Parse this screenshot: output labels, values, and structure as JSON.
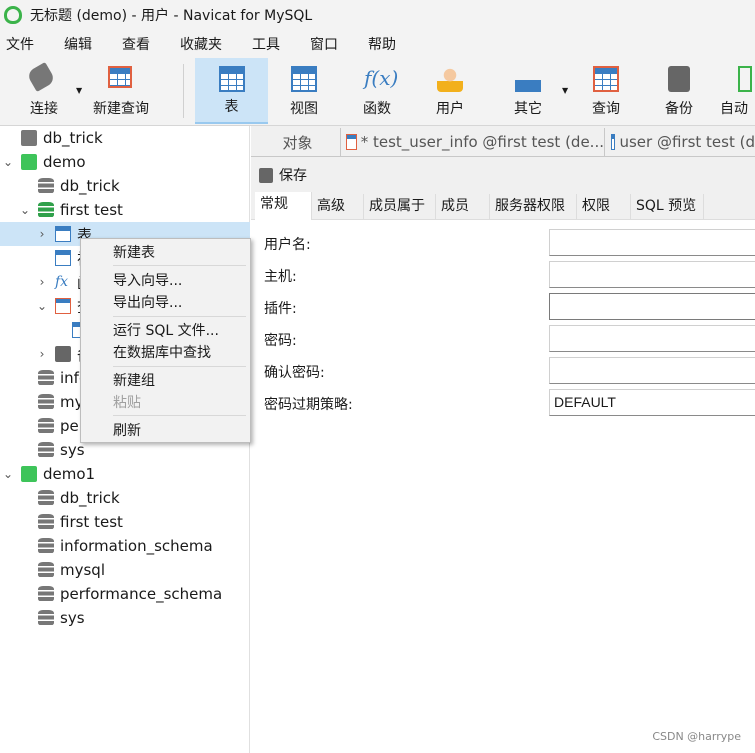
{
  "window": {
    "title": "无标题 (demo) - 用户 - Navicat for MySQL"
  },
  "menu": [
    "文件",
    "编辑",
    "查看",
    "收藏夹",
    "工具",
    "窗口",
    "帮助"
  ],
  "toolbar": {
    "connect": "连接",
    "new_query": "新建查询",
    "table": "表",
    "view": "视图",
    "function": "函数",
    "user": "用户",
    "other": "其它",
    "query": "查询",
    "backup": "备份",
    "auto": "自动"
  },
  "tree": {
    "r0": "db_trick",
    "r1": "demo",
    "r2": "db_trick",
    "r3": "first test",
    "r4": "表",
    "r5": "视",
    "r6": "函",
    "r7": "查",
    "r9": "备",
    "r10": "information_schema",
    "r11": "mysql",
    "r12": "performance_schema",
    "r13": "sys",
    "r14": "demo1",
    "r15": "db_trick",
    "r16": "first test",
    "r17": "information_schema",
    "r18": "mysql",
    "r19": "performance_schema",
    "r20": "sys"
  },
  "context_menu": {
    "new_table": "新建表",
    "import": "导入向导...",
    "export": "导出向导...",
    "run_sql": "运行 SQL 文件...",
    "find": "在数据库中查找",
    "new_group": "新建组",
    "paste": "粘贴",
    "refresh": "刷新"
  },
  "tabs": {
    "objects": "对象",
    "tab1": "* test_user_info @first test (de...",
    "tab2": "user @first test (d"
  },
  "save": "保存",
  "subtabs": [
    "常规",
    "高级",
    "成员属于",
    "成员",
    "服务器权限",
    "权限",
    "SQL 预览"
  ],
  "form": {
    "username": {
      "label": "用户名:",
      "value": ""
    },
    "host": {
      "label": "主机:",
      "value": ""
    },
    "plugin": {
      "label": "插件:",
      "value": ""
    },
    "password": {
      "label": "密码:",
      "value": ""
    },
    "confirm": {
      "label": "确认密码:",
      "value": ""
    },
    "expire": {
      "label": "密码过期策略:",
      "value": "DEFAULT"
    }
  },
  "watermark": "CSDN @harrype"
}
